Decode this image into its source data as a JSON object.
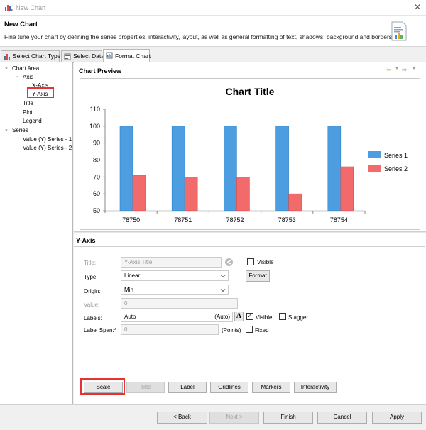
{
  "window": {
    "title": "New Chart",
    "close_symbol": "✕"
  },
  "header": {
    "title": "New Chart",
    "description": "Fine tune your chart by defining the series properties, interactivity, layout, as well as general formatting of text, shadows, background and borders."
  },
  "tabs": [
    {
      "label": "Select Chart Type"
    },
    {
      "label": "Select Data"
    },
    {
      "label": "Format Chart",
      "active": true
    }
  ],
  "tree": {
    "chart_area": "Chart Area",
    "axis": "Axis",
    "x_axis": "X-Axis",
    "y_axis": "Y-Axis",
    "title": "Title",
    "plot": "Plot",
    "legend": "Legend",
    "series": "Series",
    "series_1": "Value (Y) Series - 1",
    "series_2": "Value (Y) Series - 2"
  },
  "preview": {
    "label": "Chart Preview"
  },
  "chart_data": {
    "type": "bar",
    "title": "Chart Title",
    "categories": [
      "78750",
      "78751",
      "78752",
      "78753",
      "78754"
    ],
    "series": [
      {
        "name": "Series 1",
        "values": [
          100,
          100,
          100,
          100,
          100
        ],
        "color": "#4d9ee0"
      },
      {
        "name": "Series 2",
        "values": [
          71,
          70,
          70,
          60,
          76
        ],
        "color": "#f26a6a"
      }
    ],
    "yticks": [
      50,
      60,
      70,
      80,
      90,
      100,
      110
    ],
    "ylim": [
      50,
      110
    ],
    "legend": "right",
    "grid": false
  },
  "form": {
    "section_title": "Y-Axis",
    "title_label": "Title:",
    "title_value": "Y-Axis Title",
    "visible_label": "Visible",
    "type_label": "Type:",
    "type_value": "Linear",
    "format_button": "Format",
    "origin_label": "Origin:",
    "origin_value": "Min",
    "value_label": "Value:",
    "value_value": "0",
    "labels_label": "Labels:",
    "labels_value": "Auto",
    "labels_auto": "(Auto)",
    "font_button": "A",
    "labels_visible": "Visible",
    "stagger": "Stagger",
    "label_span_label": "Label Span:*",
    "label_span_value": "0",
    "points": "(Points)",
    "fixed": "Fixed"
  },
  "subbuttons": [
    "Scale",
    "Title",
    "Label",
    "Gridlines",
    "Markers",
    "Interactivity"
  ],
  "footer": {
    "back": "< Back",
    "next": "Next >",
    "finish": "Finish",
    "cancel": "Cancel",
    "apply": "Apply"
  },
  "colors": {
    "accent_highlight": "#e53333",
    "series1": "#4d9ee0",
    "series2": "#f26a6a"
  }
}
